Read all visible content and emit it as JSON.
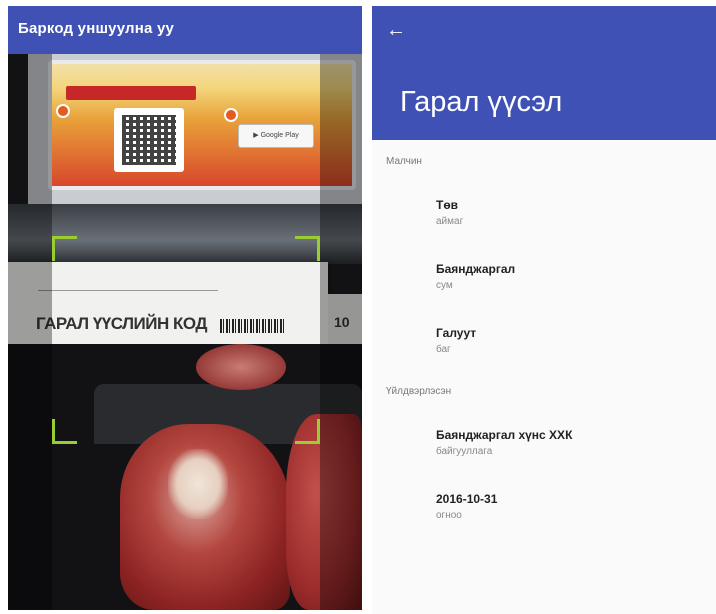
{
  "scanner": {
    "title": "Баркод уншуулна уу",
    "label_text": "ГАРАЛ ҮҮСЛИЙН КОД",
    "label_side_text": "10"
  },
  "detail": {
    "title": "Гарал үүсэл",
    "sections": [
      {
        "header": "Малчин",
        "items": [
          {
            "title": "Төв",
            "subtitle": "аймаг"
          },
          {
            "title": "Баянджаргал",
            "subtitle": "сум"
          },
          {
            "title": "Галуут",
            "subtitle": "баг"
          }
        ]
      },
      {
        "header": "Үйлдвэрлэсэн",
        "items": [
          {
            "title": "Баянджаргал хүнс ХХК",
            "subtitle": "байгууллага"
          },
          {
            "title": "2016-10-31",
            "subtitle": "огноо"
          }
        ]
      }
    ]
  },
  "colors": {
    "primary": "#3f51b5",
    "viewfinder": "#9acd32",
    "background": "#fafafa"
  },
  "icons": {
    "back": "arrow-left-icon"
  }
}
